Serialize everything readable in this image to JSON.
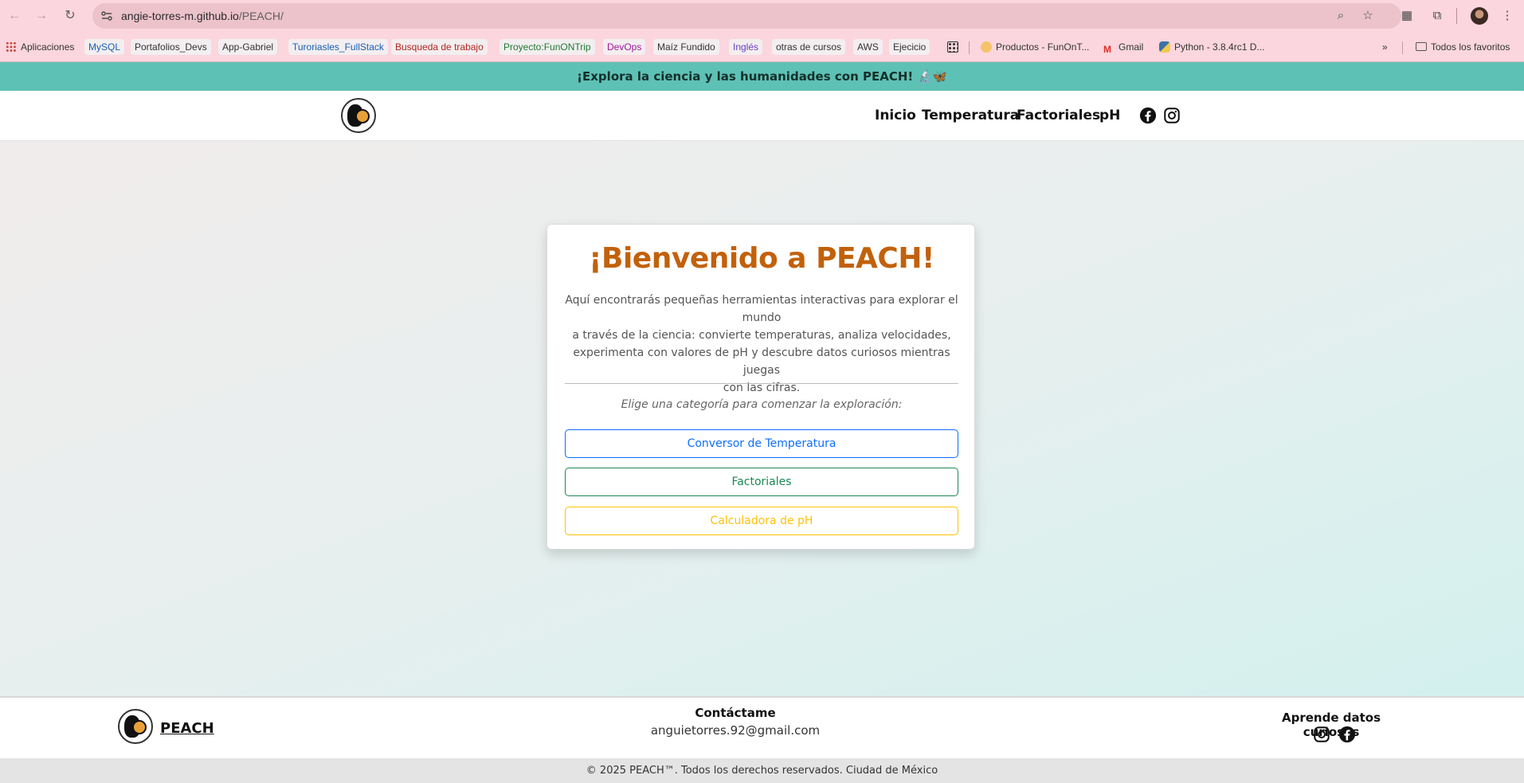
{
  "browser": {
    "url_host": "angie-torres-m.github.io",
    "url_path": "/PEACH/",
    "bookmarks": [
      {
        "label": "Aplicaciones",
        "color": "#333333"
      },
      {
        "label": "MySQL",
        "color": "#1a5fb4"
      },
      {
        "label": "Portafolios_Devs",
        "color": "#333333"
      },
      {
        "label": "App-Gabriel",
        "color": "#333333"
      },
      {
        "label": "Turoriasles_FullStack",
        "color": "#1a5fb4"
      },
      {
        "label": "Busqueda de trabajo",
        "color": "#b3261e"
      },
      {
        "label": "Proyecto:FunONTrip",
        "color": "#1e7b34"
      },
      {
        "label": "DevOps",
        "color": "#a0179c"
      },
      {
        "label": "Maíz Fundido",
        "color": "#333333"
      },
      {
        "label": "Inglés",
        "color": "#6b3fc4"
      },
      {
        "label": "otras de cursos",
        "color": "#333333"
      },
      {
        "label": "AWS",
        "color": "#333333"
      },
      {
        "label": "Ejecicio",
        "color": "#333333"
      },
      {
        "label": "Productos - FunOnT...",
        "color": "#333333"
      },
      {
        "label": "Gmail",
        "color": "#333333"
      },
      {
        "label": "Python - 3.8.4rc1 D...",
        "color": "#333333"
      }
    ],
    "all_bookmarks_label": "Todos los favoritos"
  },
  "announcement": "¡Explora la ciencia y las humanidades con PEACH! 🔬🦋",
  "nav": {
    "links": [
      "Inicio",
      "Temperatura",
      "Factoriales",
      "pH"
    ]
  },
  "card": {
    "title": "¡Bienvenido a PEACH!",
    "description_lines": [
      "Aquí encontrarás pequeñas herramientas interactivas para explorar el mundo",
      "a través de la ciencia: convierte temperaturas, analiza velocidades,",
      "experimenta con valores de pH y descubre datos curiosos mientras juegas",
      "con las cifras."
    ],
    "hint": "Elige una categoría para comenzar la exploración:",
    "buttons": {
      "temperature": "Conversor de Temperatura",
      "factorials": "Factoriales",
      "ph": "Calculadora de pH"
    }
  },
  "footer": {
    "brand": "PEACH",
    "contact_title": "Contáctame",
    "contact_email": "anguietorres.92@gmail.com",
    "curious_title": "Aprende datos curiosos"
  },
  "copyright": "© 2025 PEACH™. Todos los derechos reservados. Ciudad de México",
  "colors": {
    "announcement_bg": "#5ec1b5",
    "title": "#c2610b",
    "btn_blue": "#0d6efd",
    "btn_green": "#198754",
    "btn_yellow": "#ffc107"
  }
}
